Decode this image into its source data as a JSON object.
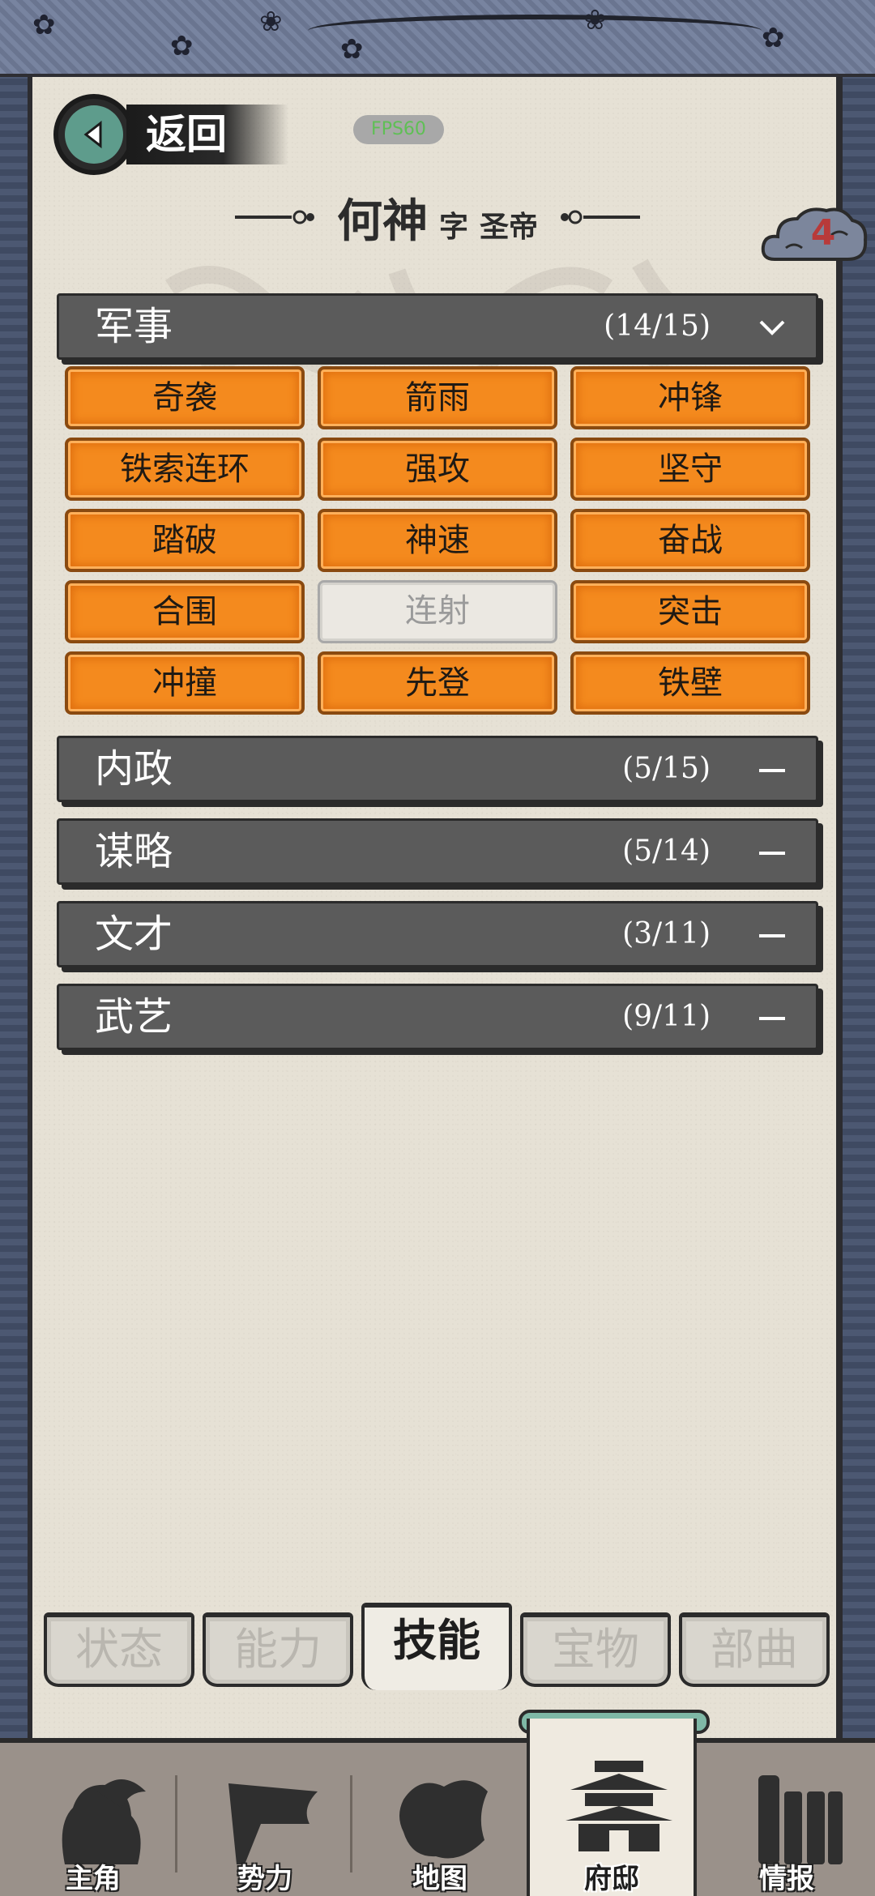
{
  "header": {
    "back_label": "返回",
    "fps_label": "FPS60"
  },
  "character": {
    "name": "何神",
    "courtesy_label": "字",
    "courtesy_name": "圣帝"
  },
  "badge": {
    "count": "4",
    "color": "#b83a3a"
  },
  "sections": [
    {
      "title": "军事",
      "count": "(14/15)",
      "expanded": true,
      "skills": [
        {
          "label": "奇袭",
          "active": true
        },
        {
          "label": "箭雨",
          "active": true
        },
        {
          "label": "冲锋",
          "active": true
        },
        {
          "label": "铁索连环",
          "active": true
        },
        {
          "label": "强攻",
          "active": true
        },
        {
          "label": "坚守",
          "active": true
        },
        {
          "label": "踏破",
          "active": true
        },
        {
          "label": "神速",
          "active": true
        },
        {
          "label": "奋战",
          "active": true
        },
        {
          "label": "合围",
          "active": true
        },
        {
          "label": "连射",
          "active": false
        },
        {
          "label": "突击",
          "active": true
        },
        {
          "label": "冲撞",
          "active": true
        },
        {
          "label": "先登",
          "active": true
        },
        {
          "label": "铁壁",
          "active": true
        }
      ]
    },
    {
      "title": "内政",
      "count": "(5/15)",
      "expanded": false
    },
    {
      "title": "谋略",
      "count": "(5/14)",
      "expanded": false
    },
    {
      "title": "文才",
      "count": "(3/11)",
      "expanded": false
    },
    {
      "title": "武艺",
      "count": "(9/11)",
      "expanded": false
    }
  ],
  "tabs": [
    {
      "label": "状态",
      "active": false
    },
    {
      "label": "能力",
      "active": false
    },
    {
      "label": "技能",
      "active": true
    },
    {
      "label": "宝物",
      "active": false
    },
    {
      "label": "部曲",
      "active": false
    }
  ],
  "bottom_nav": [
    {
      "label": "主角",
      "icon": "hero-portrait-icon",
      "active": false
    },
    {
      "label": "势力",
      "icon": "faction-flag-icon",
      "active": false
    },
    {
      "label": "地图",
      "icon": "map-icon",
      "active": false
    },
    {
      "label": "府邸",
      "icon": "mansion-icon",
      "active": true
    },
    {
      "label": "情报",
      "icon": "intel-scrolls-icon",
      "active": false
    }
  ],
  "colors": {
    "skill_active": "#f48a1e",
    "section_bar": "#5b5b5b",
    "paper": "#e6e1d5",
    "accent_teal": "#5e9c8c"
  }
}
